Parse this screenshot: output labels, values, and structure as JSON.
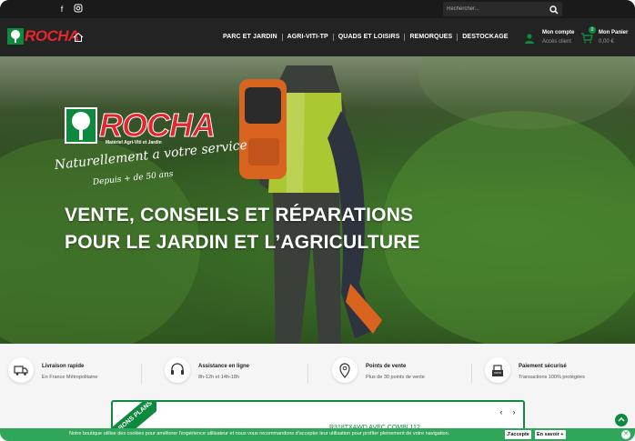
{
  "topbar": {
    "social": [
      {
        "name": "facebook-icon",
        "glyph": "f"
      },
      {
        "name": "instagram-icon",
        "glyph": "◎"
      }
    ],
    "search_placeholder": "Rechercher..."
  },
  "header": {
    "logo_text": "ROCHA",
    "nav": [
      "PARC ET JARDIN",
      "AGRI-VITI-TP",
      "QUADS ET LOISIRS",
      "REMORQUES",
      "DESTOCKAGE"
    ],
    "account": {
      "title": "Mon compte",
      "subtitle": "Accès client"
    },
    "cart": {
      "title": "Mon Panier",
      "subtitle": "0,00 €",
      "count": "0"
    }
  },
  "hero": {
    "logo_text": "ROCHA",
    "logo_sub": "Matériel Agri-Viti et Jardin",
    "tagline": "Naturellement a votre service",
    "tagline2": "Depuis + de 50 ans",
    "headline_line1": "VENTE, CONSEILS ET RÉPARATIONS",
    "headline_line2": "POUR LE JARDIN ET L’AGRICULTURE"
  },
  "features": [
    {
      "icon": "truck-icon",
      "title": "Livraison rapide",
      "subtitle": "En France Métropolitaine"
    },
    {
      "icon": "headset-icon",
      "title": "Assistance en ligne",
      "subtitle": "8h-12h et 14h-18h"
    },
    {
      "icon": "map-pin-icon",
      "title": "Points de vente",
      "subtitle": "Plus de 30 points de vente"
    },
    {
      "icon": "secure-payment-icon",
      "title": "Paiement sécurisé",
      "subtitle": "Transactions 100% protégées"
    }
  ],
  "promo": {
    "ribbon": "BONS PLANS",
    "product_title": "R318TXAWD AVEC COMBI 112..."
  },
  "cookie": {
    "text": "Notre boutique utilise des cookies pour améliorer l'expérience utilisateur et nous vous recommandons d'accepter leur utilisation pour profiter pleinement de votre navigation.",
    "accept": "J'accepte",
    "more": "En savoir +"
  },
  "colors": {
    "brand_green": "#0e8a3f",
    "brand_red": "#e3262c",
    "cookie_green": "#2fa65a"
  }
}
